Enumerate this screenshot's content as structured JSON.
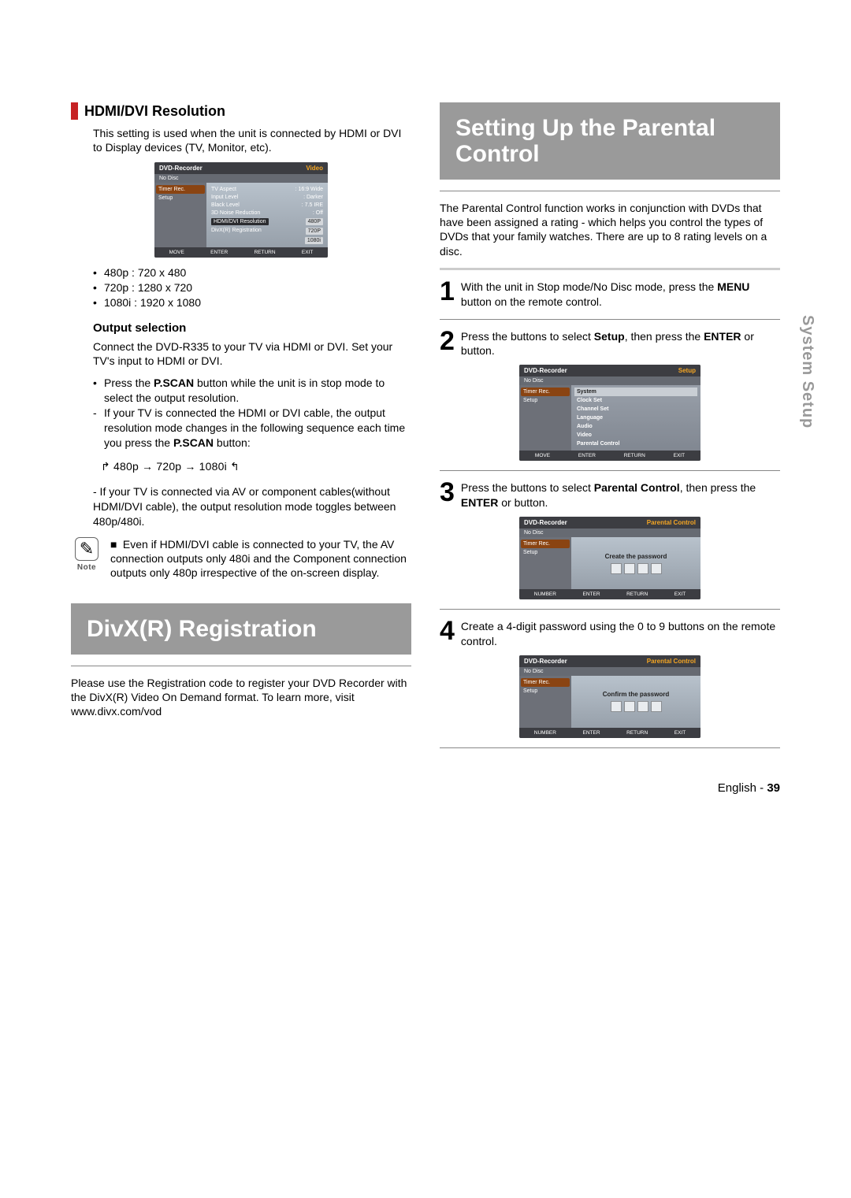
{
  "left": {
    "hdmi": {
      "heading": "HDMI/DVI Resolution",
      "intro": "This setting is used when the unit is connected by HDMI or DVI to Display devices (TV, Monitor, etc).",
      "osd1": {
        "title": "DVD-Recorder",
        "corner": "Video",
        "nodisc": "No Disc",
        "nav": [
          "Timer Rec.",
          "Setup"
        ],
        "rows": [
          {
            "lab": "TV Aspect",
            "val": ": 16:9 Wide"
          },
          {
            "lab": "Input Level",
            "val": ": Darker"
          },
          {
            "lab": "Black Level",
            "val": ": 7.5 IRE"
          },
          {
            "lab": "3D Noise Reduction",
            "val": ": Off"
          },
          {
            "lab": "HDMI/DVI Resolution",
            "val": "480P",
            "hl": true
          },
          {
            "lab": "DivX(R) Registration",
            "val": "720P",
            "hlv": true
          },
          {
            "lab": "",
            "val": "1080i",
            "hlv": true
          }
        ],
        "footer": [
          "MOVE",
          "ENTER",
          "RETURN",
          "EXIT"
        ]
      },
      "res_bullets": [
        "480p : 720 x 480",
        "720p : 1280 x 720",
        "1080i : 1920 x 1080"
      ],
      "output_heading": "Output selection",
      "output_intro": "Connect the DVD-R335 to your TV via HDMI or DVI. Set your TV's input to HDMI or DVI.",
      "output_bullets": [
        "Press the P.SCAN button while the unit is in stop mode to select the output resolution.",
        "If your TV is connected the HDMI or DVI cable, the output resolution mode changes in the following sequence each time you press the P.SCAN button:"
      ],
      "cycle": "↱ 480p → 720p → 1080i ↰",
      "after_cycle": "- If your TV is connected via AV or component cables(without HDMI/DVI cable), the output resolution mode toggles between 480p/480i.",
      "note_label": "Note",
      "note_body": "Even if  HDMI/DVI cable is connected to your TV, the AV connection outputs only 480i and the Component connection outputs only 480p irrespective of the on-screen display."
    },
    "divx": {
      "banner": "DivX(R) Registration",
      "body": "Please use the Registration code to register your DVD Recorder with the DivX(R) Video On Demand format. To learn more, visit www.divx.com/vod"
    }
  },
  "right": {
    "banner": "Setting Up the Parental Control",
    "intro": "The Parental Control function works in conjunction with DVDs that have been assigned a rating - which helps you control the types of DVDs that your family watches. There are up to 8 rating levels on a disc.",
    "step1_a": "With the unit in Stop mode/No Disc mode, press the ",
    "step1_b": "MENU",
    "step1_c": " button on the remote control.",
    "step2_a": "Press the        buttons to select ",
    "step2_b": "Setup",
    "step2_c": ", then press the ",
    "step2_d": "ENTER",
    "step2_e": " or        button.",
    "osd2": {
      "title": "DVD-Recorder",
      "corner": "Setup",
      "nodisc": "No Disc",
      "nav": [
        "Timer Rec.",
        "Setup"
      ],
      "list": [
        "System",
        "Clock Set",
        "Channel Set",
        "Language",
        "Audio",
        "Video",
        "Parental Control"
      ],
      "footer": [
        "MOVE",
        "ENTER",
        "RETURN",
        "EXIT"
      ]
    },
    "step3_a": "Press the        buttons to select ",
    "step3_b": "Parental Control",
    "step3_c": ", then press the ",
    "step3_d": "ENTER",
    "step3_e": " or        button.",
    "osd3": {
      "title": "DVD-Recorder",
      "corner": "Parental Control",
      "nodisc": "No Disc",
      "nav": [
        "Timer Rec.",
        "Setup"
      ],
      "msg": "Create the password",
      "footer": [
        "NUMBER",
        "ENTER",
        "RETURN",
        "EXIT"
      ]
    },
    "step4": "Create a 4-digit password using the 0 to 9 buttons on the remote control.",
    "osd4": {
      "title": "DVD-Recorder",
      "corner": "Parental Control",
      "nodisc": "No Disc",
      "nav": [
        "Timer Rec.",
        "Setup"
      ],
      "msg": "Confirm the password",
      "footer": [
        "NUMBER",
        "ENTER",
        "RETURN",
        "EXIT"
      ]
    }
  },
  "side_tab": "System Setup",
  "pagefoot_a": "English - ",
  "pagefoot_b": "39"
}
